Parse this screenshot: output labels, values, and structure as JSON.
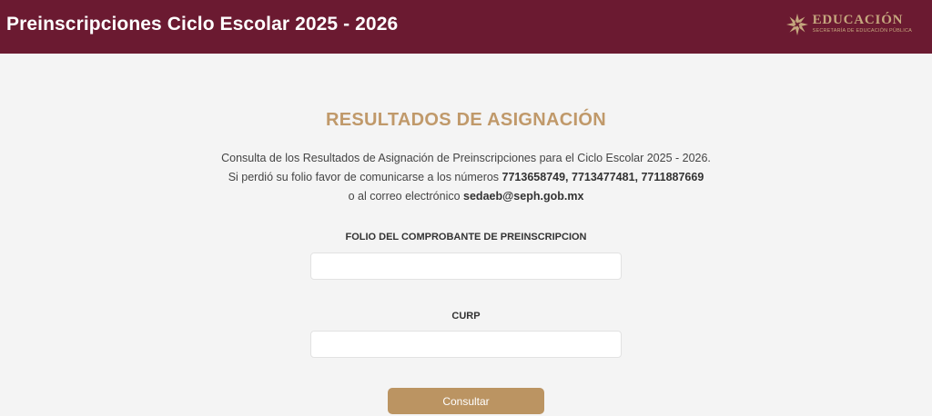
{
  "header": {
    "title": "Preinscripciones Ciclo Escolar 2025 - 2026",
    "logo": {
      "icon": "star-flower-icon",
      "main_text": "EDUCACIÓN",
      "sub_text": "SECRETARÍA DE EDUCACIÓN PÚBLICA"
    }
  },
  "main": {
    "title": "RESULTADOS DE ASIGNACIÓN",
    "description": {
      "line1": "Consulta de los Resultados de Asignación de Preinscripciones para el Ciclo Escolar 2025 - 2026.",
      "line2_prefix": "Si perdió su folio favor de comunicarse a los números ",
      "phones": "7713658749, 7713477481, 7711887669",
      "line3_prefix": "o al correo electrónico ",
      "email": "sedaeb@seph.gob.mx"
    },
    "form": {
      "folio_label": "FOLIO DEL COMPROBANTE DE PREINSCRIPCION",
      "folio_value": "",
      "curp_label": "CURP",
      "curp_value": "",
      "submit_label": "Consultar"
    }
  },
  "colors": {
    "header_bg": "#6b1a31",
    "title_gold": "#c0996a",
    "button_gold": "#bb9462",
    "page_bg": "#f4f4f4"
  }
}
